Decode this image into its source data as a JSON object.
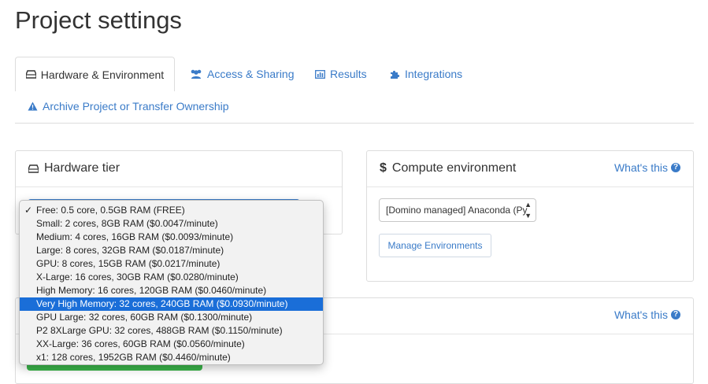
{
  "page": {
    "title": "Project settings"
  },
  "tabs": [
    {
      "label": "Hardware & Environment",
      "icon": "hdd-icon",
      "active": true
    },
    {
      "label": "Access & Sharing",
      "icon": "users-icon"
    },
    {
      "label": "Results",
      "icon": "bar-chart-icon"
    },
    {
      "label": "Integrations",
      "icon": "puzzle-icon"
    },
    {
      "label": "Archive Project or Transfer Ownership",
      "icon": "warning-icon"
    }
  ],
  "hardware_panel": {
    "title": "Hardware tier",
    "icon": "hdd-icon"
  },
  "compute_panel": {
    "title": "Compute environment",
    "icon_glyph": "$",
    "whats_this": "What's this",
    "selected_env": "[Domino managed] Anaconda (Py",
    "manage_button": "Manage Environments"
  },
  "lower_panel": {
    "whats_this": "What's this"
  },
  "hardware_tiers": {
    "selected_index": 7,
    "checked_index": 0,
    "options": [
      "Free: 0.5 core, 0.5GB RAM (FREE)",
      "Small: 2 cores, 8GB RAM ($0.0047/minute)",
      "Medium: 4 cores, 16GB RAM ($0.0093/minute)",
      "Large: 8 cores, 32GB RAM ($0.0187/minute)",
      "GPU: 8 cores, 15GB RAM ($0.0217/minute)",
      "X-Large: 16 cores, 30GB RAM ($0.0280/minute)",
      "High Memory: 16 cores, 120GB RAM ($0.0460/minute)",
      "Very High Memory: 32 cores, 240GB RAM ($0.0930/minute)",
      "GPU Large: 32 cores, 60GB RAM ($0.1300/minute)",
      "P2 8XLarge GPU: 32 cores, 488GB RAM ($0.1150/minute)",
      "XX-Large: 36 cores, 60GB RAM ($0.0560/minute)",
      "x1: 128 cores, 1952GB RAM ($0.4460/minute)"
    ]
  },
  "colors": {
    "link": "#3a7bc8",
    "selected": "#1a6ed8",
    "success": "#3bb54a"
  }
}
